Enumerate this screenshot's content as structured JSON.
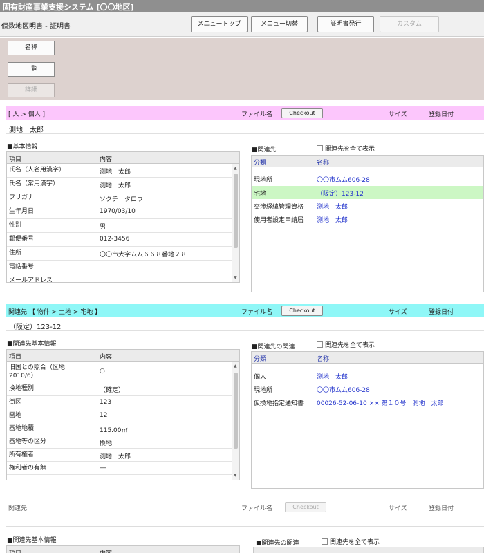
{
  "app": {
    "title": "固有財産事業支援システム [〇〇地区]"
  },
  "header": {
    "page_title": "個数地区明書 - 証明書",
    "buttons": {
      "menu_top": "メニュートップ",
      "menu_switch": "メニュー切替",
      "issue_cert": "証明書発行",
      "custom": "カスタム"
    }
  },
  "nav": {
    "search": "名称",
    "list": "一覧",
    "detail": "詳細"
  },
  "common": {
    "file_label": "ファイル名",
    "checkout": "Checkout",
    "size_label": "サイズ",
    "date_label": "登録日付",
    "show_all": "関連先を全て表示"
  },
  "section1": {
    "path": "[ 人 > 個人 ]",
    "record_name": "測地　太郎",
    "basic_title": "■基本情報",
    "columns": [
      "項目",
      "内容"
    ],
    "rows": [
      {
        "k": "氏名（人名用漢字）",
        "v": "測地　太郎"
      },
      {
        "k": "氏名（常用漢字）",
        "v": "測地　太郎"
      },
      {
        "k": "フリガナ",
        "v": "ソクチ　タロウ"
      },
      {
        "k": "生年月日",
        "v": "1970/03/10"
      },
      {
        "k": "性別",
        "v": "男"
      },
      {
        "k": "郵便番号",
        "v": "012-3456"
      },
      {
        "k": "住所",
        "v": "〇〇市大字ムム６６８番地２８"
      },
      {
        "k": "電話番号",
        "v": ""
      },
      {
        "k": "メールアドレス",
        "v": ""
      }
    ],
    "related_title": "■関連先",
    "related_columns": [
      "分類",
      "名称"
    ],
    "related": [
      {
        "k": "現地所",
        "v": "〇〇市ムム606-28"
      },
      {
        "k": "宅地",
        "v": "（阪定）123-12"
      },
      {
        "k": "交渉経緯管理資格",
        "v": "測地　太郎"
      },
      {
        "k": "使用者設定申請届",
        "v": "測地　太郎"
      }
    ]
  },
  "section2": {
    "path": "関連先 【 物件 > 土地 > 宅地 】",
    "record_name": "（阪定）123-12",
    "basic_title": "■関連先基本情報",
    "columns": [
      "項目",
      "内容"
    ],
    "rows": [
      {
        "k": "旧国との照合（区地\n2010/6）",
        "v": "○"
      },
      {
        "k": "換地種別",
        "v": "（確定）"
      },
      {
        "k": "街区",
        "v": "123"
      },
      {
        "k": "画地",
        "v": "12"
      },
      {
        "k": "画地地積",
        "v": "115.00㎡"
      },
      {
        "k": "画地等の区分",
        "v": "換地"
      },
      {
        "k": "所有権者",
        "v": "測地　太郎"
      },
      {
        "k": "権利者の有無",
        "v": "―"
      }
    ],
    "related_title": "■関連先の関連",
    "related_columns": [
      "分類",
      "名称"
    ],
    "related": [
      {
        "k": "個人",
        "v": "測地　太郎"
      },
      {
        "k": "現地所",
        "v": "〇〇市ムム606-28"
      },
      {
        "k": "仮換地指定通知書",
        "v": "00026-52-06-10 ×× 第１０号　測地　太郎"
      }
    ]
  },
  "section3": {
    "path": "関連先",
    "basic_title": "■関連先基本情報",
    "related_title": "■関連先の関連",
    "columns": [
      "項目",
      "内容"
    ]
  }
}
